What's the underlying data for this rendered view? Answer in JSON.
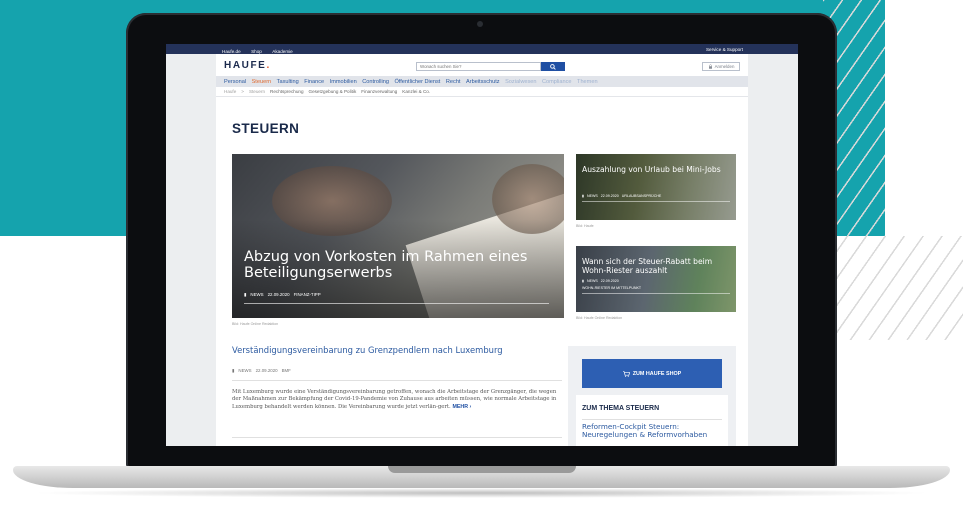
{
  "topbar": {
    "links": [
      "Haufe.de",
      "Shop",
      "Akademie"
    ],
    "right": "Service & Support"
  },
  "header": {
    "logo": "HAUFE",
    "logo_dot": ".",
    "search_placeholder": "Wonach suchen Sie?",
    "login_label": "Anmelden"
  },
  "nav": {
    "items": [
      {
        "label": "Personal",
        "state": "normal"
      },
      {
        "label": "Steuern",
        "state": "active"
      },
      {
        "label": "Taxulting",
        "state": "normal"
      },
      {
        "label": "Finance",
        "state": "normal"
      },
      {
        "label": "Immobilien",
        "state": "normal"
      },
      {
        "label": "Controlling",
        "state": "normal"
      },
      {
        "label": "Öffentlicher Dienst",
        "state": "normal"
      },
      {
        "label": "Recht",
        "state": "normal"
      },
      {
        "label": "Arbeitsschutz",
        "state": "normal"
      },
      {
        "label": "Sozialwesen",
        "state": "faded"
      },
      {
        "label": "Compliance",
        "state": "faded"
      },
      {
        "label": "Themen",
        "state": "faded"
      }
    ]
  },
  "breadcrumb": [
    "Haufe",
    ">",
    "Steuern",
    "Rechtsprechung",
    "Gesetzgebung & Politik",
    "Finanzverwaltung",
    "Kanzlei & Co."
  ],
  "page_title": "STEUERN",
  "hero": {
    "title": "Abzug von Vorkosten im Rahmen eines Beteiligungserwerbs",
    "type": "NEWS",
    "date": "22.09.2020",
    "tag": "FINANZ-TIPP",
    "caption": "Bild: Haufe Online Redaktion"
  },
  "teasers": [
    {
      "title": "Auszahlung von Urlaub bei Mini-Jobs",
      "type": "NEWS",
      "date": "22.09.2020",
      "tag": "URLAUBSANSPRÜCHE",
      "caption": "Bild: Haufe"
    },
    {
      "title": "Wann sich der Steuer-Rabatt beim Wohn-Riester auszahlt",
      "type": "NEWS",
      "date": "22.09.2020",
      "tag": "WOHN-RIESTER IM MITTELPUNKT",
      "caption": "Bild: Haufe Online Redaktion"
    }
  ],
  "article": {
    "title": "Verständigungsvereinbarung zu Grenzpendlern nach Luxemburg",
    "type": "NEWS",
    "date": "22.09.2020",
    "tag": "BMF",
    "body": "Mit Luxemburg wurde eine Verständigungsvereinbarung getroffen, wonach die Arbeitstage der Grenzgänger, die wegen der Maßnahmen zur Bekämpfung der Covid-19-Pandemie von Zuhause aus arbeiten müssen, wie normale Arbeitstage in Luxemburg behandelt werden können. Die Vereinbarung wurde jetzt verlän-gert.",
    "more_label": "MEHR",
    "more_icon": "›"
  },
  "sidebar": {
    "shop_label": "ZUM HAUFE SHOP",
    "thema_heading": "ZUM THEMA STEUERN",
    "thema_link": "Reformen-Cockpit Steuern: Neuregelungen & Reformvorhaben"
  }
}
